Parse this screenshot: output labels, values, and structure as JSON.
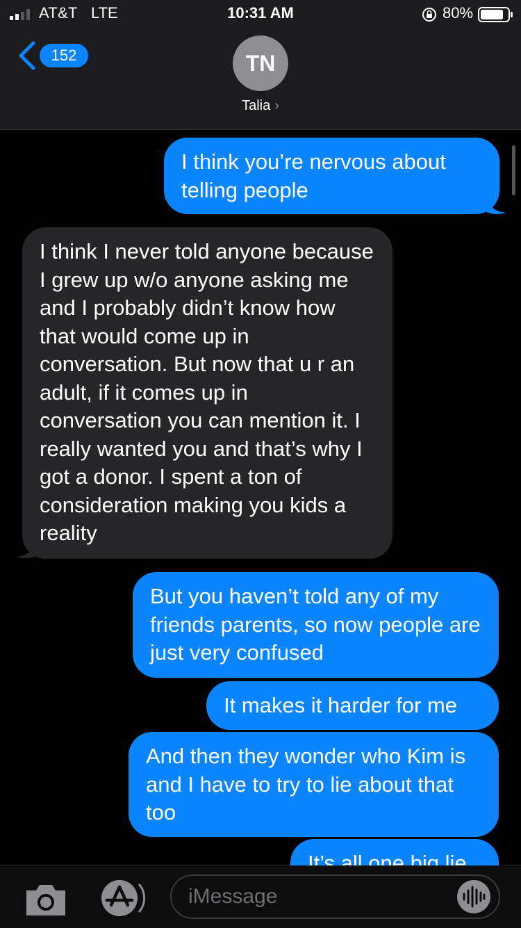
{
  "status": {
    "carrier": "AT&T",
    "network": "LTE",
    "time": "10:31 AM",
    "battery": "80%"
  },
  "header": {
    "back_count": "152",
    "avatar_initials": "TN",
    "contact_name": "Talia",
    "contact_chevron": "›"
  },
  "messages": [
    {
      "from": "me",
      "text": "I think you’re nervous about telling people"
    },
    {
      "from": "them",
      "text": "I think I never told anyone because I grew up w/o anyone asking me and I probably didn’t know how that would come up in conversation. But now that u r an adult, if it comes up in conversation you can mention it. I really wanted you and that’s why I got a donor. I spent a ton of consideration making you kids a reality"
    },
    {
      "from": "me",
      "text": "But you haven’t told any of my friends parents, so now people are just very confused"
    },
    {
      "from": "me",
      "text": "It makes it harder for me"
    },
    {
      "from": "me",
      "text": "And then they wonder who Kim is and I have to try to lie about that too"
    },
    {
      "from": "me",
      "text": "It’s all one big lie"
    }
  ],
  "input": {
    "placeholder": "iMessage"
  },
  "colors": {
    "sent_bubble": "#0a84ff",
    "received_bubble": "#262628",
    "background": "#000000",
    "header": "#1c1c1e"
  },
  "icons": [
    "signal-icon",
    "lock-rotation-icon",
    "battery-icon",
    "back-chevron-icon",
    "camera-icon",
    "app-store-icon",
    "audio-waveform-icon"
  ]
}
